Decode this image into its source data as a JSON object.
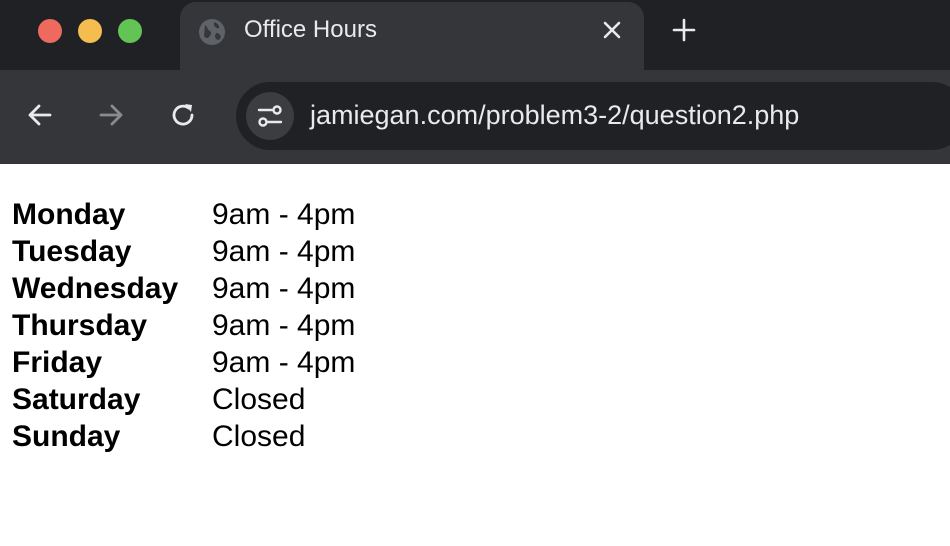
{
  "browser": {
    "tab": {
      "title": "Office Hours"
    },
    "address_bar": {
      "url": "jamiegan.com/problem3-2/question2.php"
    }
  },
  "schedule": [
    {
      "day": "Monday",
      "hours": "9am - 4pm"
    },
    {
      "day": "Tuesday",
      "hours": "9am - 4pm"
    },
    {
      "day": "Wednesday",
      "hours": "9am - 4pm"
    },
    {
      "day": "Thursday",
      "hours": "9am - 4pm"
    },
    {
      "day": "Friday",
      "hours": "9am - 4pm"
    },
    {
      "day": "Saturday",
      "hours": "Closed"
    },
    {
      "day": "Sunday",
      "hours": "Closed"
    }
  ],
  "colors": {
    "tabstrip_bg": "#202124",
    "toolbar_bg": "#35363a",
    "close_red": "#ee6a5f",
    "minimize_yellow": "#f5bd4f",
    "zoom_green": "#61c454"
  },
  "icons": [
    "globe-icon",
    "close-icon",
    "plus-icon",
    "back-arrow-icon",
    "forward-arrow-icon",
    "reload-icon",
    "tune-icon"
  ]
}
